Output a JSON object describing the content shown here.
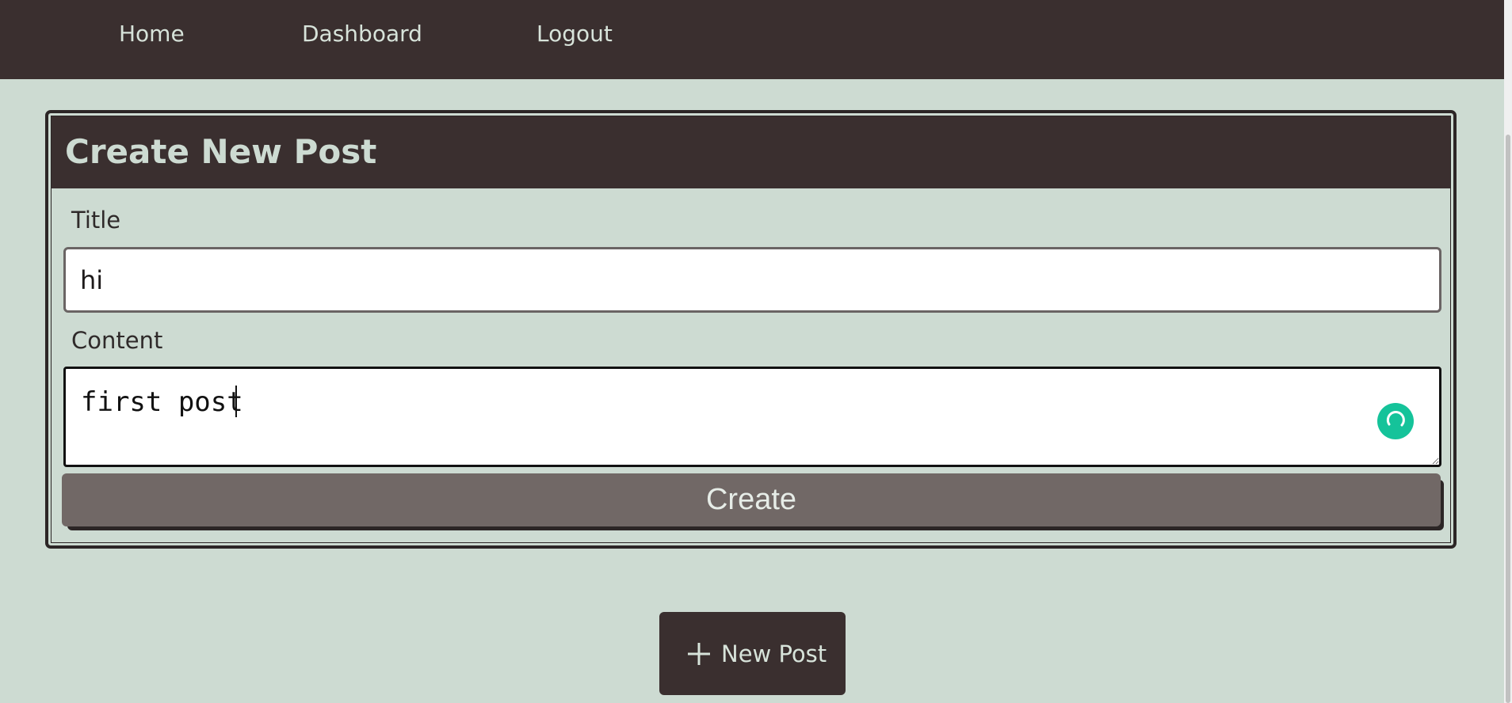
{
  "nav": {
    "home": "Home",
    "dashboard": "Dashboard",
    "logout": "Logout"
  },
  "form": {
    "heading": "Create New Post",
    "title_label": "Title",
    "title_value": "hi",
    "content_label": "Content",
    "content_value": "first post",
    "submit_label": "Create"
  },
  "new_post_button": {
    "label": "New Post",
    "icon": "plus-icon"
  },
  "extension_icon": "grammarly-icon",
  "colors": {
    "background": "#cddbd2",
    "nav_bg": "#3a2f2f",
    "nav_text": "#d7e3da",
    "submit_bg": "#716866",
    "extension_green": "#15c39a"
  }
}
